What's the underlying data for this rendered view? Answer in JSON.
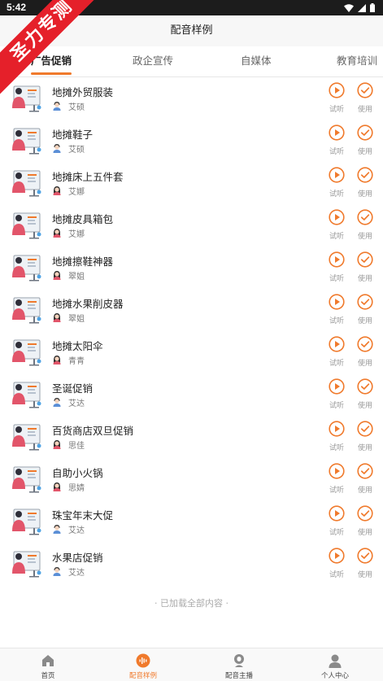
{
  "status_bar": {
    "time": "5:42"
  },
  "ribbon": {
    "text": "圣力专测"
  },
  "header": {
    "title": "配音样例"
  },
  "tabs": [
    {
      "label": "广告促销",
      "active": true
    },
    {
      "label": "政企宣传",
      "active": false
    },
    {
      "label": "自媒体",
      "active": false
    },
    {
      "label": "教育培训",
      "active": false
    }
  ],
  "colors": {
    "accent": "#f07a2c",
    "status_bar": "#1c1c1c",
    "ribbon": "#e5202a"
  },
  "actions": {
    "listen_label": "试听",
    "use_label": "使用"
  },
  "items": [
    {
      "title": "地摊外贸服装",
      "voice": "艾硕",
      "gender": "male"
    },
    {
      "title": "地摊鞋子",
      "voice": "艾硕",
      "gender": "male"
    },
    {
      "title": "地摊床上五件套",
      "voice": "艾娜",
      "gender": "female"
    },
    {
      "title": "地摊皮具箱包",
      "voice": "艾娜",
      "gender": "female"
    },
    {
      "title": "地摊擦鞋神器",
      "voice": "翠姐",
      "gender": "female"
    },
    {
      "title": "地摊水果削皮器",
      "voice": "翠姐",
      "gender": "female"
    },
    {
      "title": "地摊太阳伞",
      "voice": "青青",
      "gender": "female"
    },
    {
      "title": "圣诞促销",
      "voice": "艾达",
      "gender": "male"
    },
    {
      "title": "百货商店双旦促销",
      "voice": "思佳",
      "gender": "female"
    },
    {
      "title": "自助小火锅",
      "voice": "思婧",
      "gender": "female"
    },
    {
      "title": "珠宝年末大促",
      "voice": "艾达",
      "gender": "male"
    },
    {
      "title": "水果店促销",
      "voice": "艾达",
      "gender": "male"
    }
  ],
  "footer_note": "· 已加载全部内容 ·",
  "tabbar": [
    {
      "label": "首页",
      "icon": "home-icon",
      "active": false
    },
    {
      "label": "配音样例",
      "icon": "audio-wave-icon",
      "active": true
    },
    {
      "label": "配音主播",
      "icon": "anchor-icon",
      "active": false
    },
    {
      "label": "个人中心",
      "icon": "person-icon",
      "active": false
    }
  ]
}
